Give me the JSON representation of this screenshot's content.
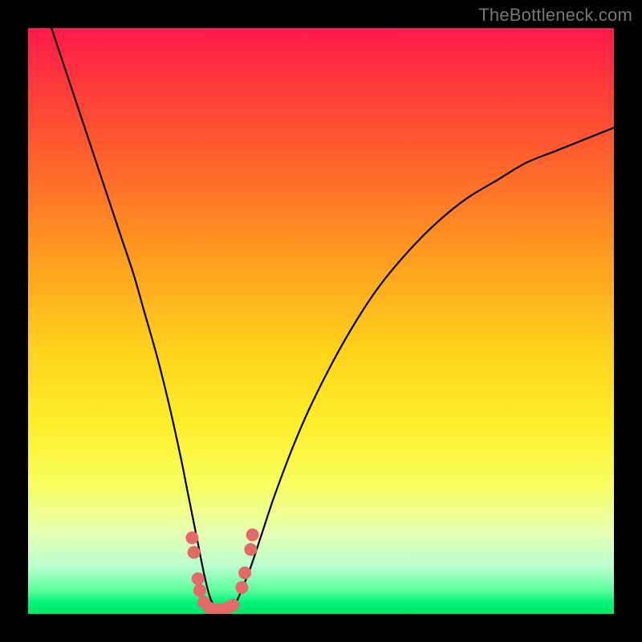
{
  "watermark": "TheBottleneck.com",
  "chart_data": {
    "type": "line",
    "title": "",
    "xlabel": "",
    "ylabel": "",
    "xlim": [
      0,
      100
    ],
    "ylim": [
      0,
      100
    ],
    "grid": false,
    "legend": false,
    "series": [
      {
        "name": "bottleneck-curve",
        "x": [
          4,
          6,
          8,
          10,
          12,
          14,
          16,
          18,
          20,
          22,
          24,
          26,
          27,
          28,
          29,
          30,
          31,
          32,
          33,
          34,
          35,
          36,
          38,
          40,
          42,
          45,
          48,
          52,
          56,
          60,
          65,
          70,
          75,
          80,
          85,
          90,
          95,
          100
        ],
        "y": [
          100,
          94,
          88,
          82,
          76,
          70,
          64,
          58,
          51,
          44,
          36,
          27,
          22,
          17,
          12,
          7,
          3,
          1,
          0,
          0,
          1,
          3,
          8,
          14,
          20,
          28,
          35,
          43,
          50,
          56,
          62,
          67,
          71,
          74,
          77,
          79,
          81,
          83
        ]
      }
    ],
    "markers": {
      "comment": "salmon dot cluster near trough",
      "color": "#e46a6a",
      "points_xy": [
        [
          28,
          13
        ],
        [
          28.3,
          10.5
        ],
        [
          29,
          6
        ],
        [
          29.3,
          4
        ],
        [
          30,
          2
        ],
        [
          31,
          1
        ],
        [
          32,
          0.7
        ],
        [
          33,
          0.7
        ],
        [
          34,
          1
        ],
        [
          35,
          1.5
        ],
        [
          36.5,
          4.5
        ],
        [
          37,
          7
        ],
        [
          38,
          11
        ],
        [
          38.3,
          13.5
        ]
      ]
    },
    "background_gradient": {
      "top": "#ff1a4d",
      "upper_mid": "#ffa01f",
      "lower_mid": "#ffef2a",
      "bottom": "#00e86b"
    }
  }
}
